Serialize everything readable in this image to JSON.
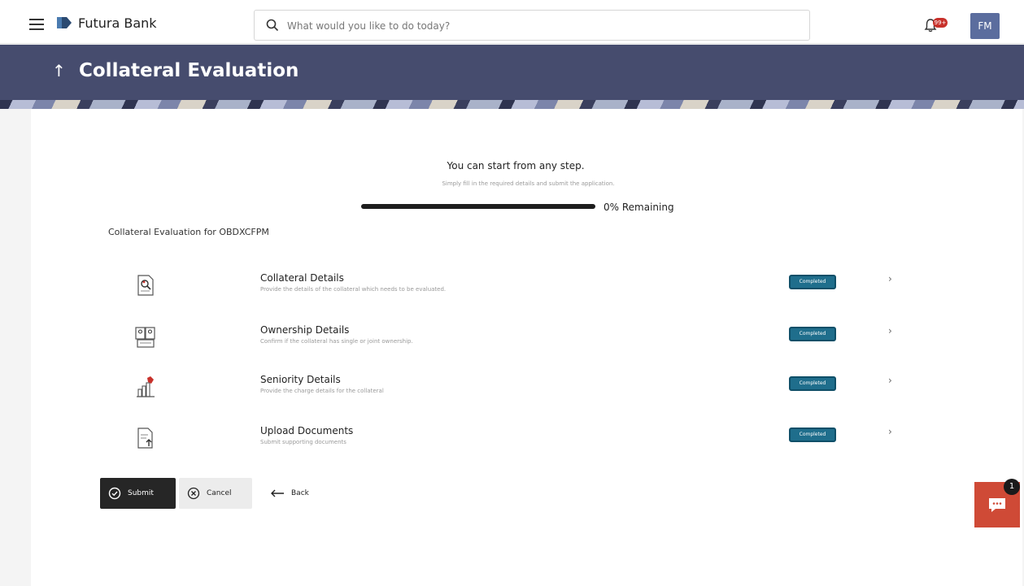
{
  "header": {
    "brand": "Futura Bank",
    "search_placeholder": "What would you like to do today?",
    "notification_count": "99+",
    "avatar_initials": "FM"
  },
  "page": {
    "title": "Collateral Evaluation"
  },
  "intro": {
    "title": "You can start from any step.",
    "subtitle": "Simply fill in the required details and submit the application.",
    "progress_remaining_pct": 0,
    "progress_label": "0% Remaining"
  },
  "evaluation_for": "Collateral Evaluation for OBDXCFPM",
  "steps": [
    {
      "icon": "collateral-details-icon",
      "title": "Collateral Details",
      "description": "Provide the details of the collateral which needs to be evaluated.",
      "status": "Completed"
    },
    {
      "icon": "ownership-details-icon",
      "title": "Ownership Details",
      "description": "Confirm if the collateral has single or joint ownership.",
      "status": "Completed"
    },
    {
      "icon": "seniority-details-icon",
      "title": "Seniority Details",
      "description": "Provide the charge details for the collateral",
      "status": "Completed"
    },
    {
      "icon": "upload-documents-icon",
      "title": "Upload Documents",
      "description": "Submit supporting documents",
      "status": "Completed"
    }
  ],
  "actions": {
    "submit": "Submit",
    "cancel": "Cancel",
    "back": "Back"
  },
  "chat": {
    "unread": "1"
  },
  "colors": {
    "header_band": "#464c6e",
    "badge": "#1f6e8c",
    "submit_button": "#262626",
    "chat": "#cf4a36"
  }
}
